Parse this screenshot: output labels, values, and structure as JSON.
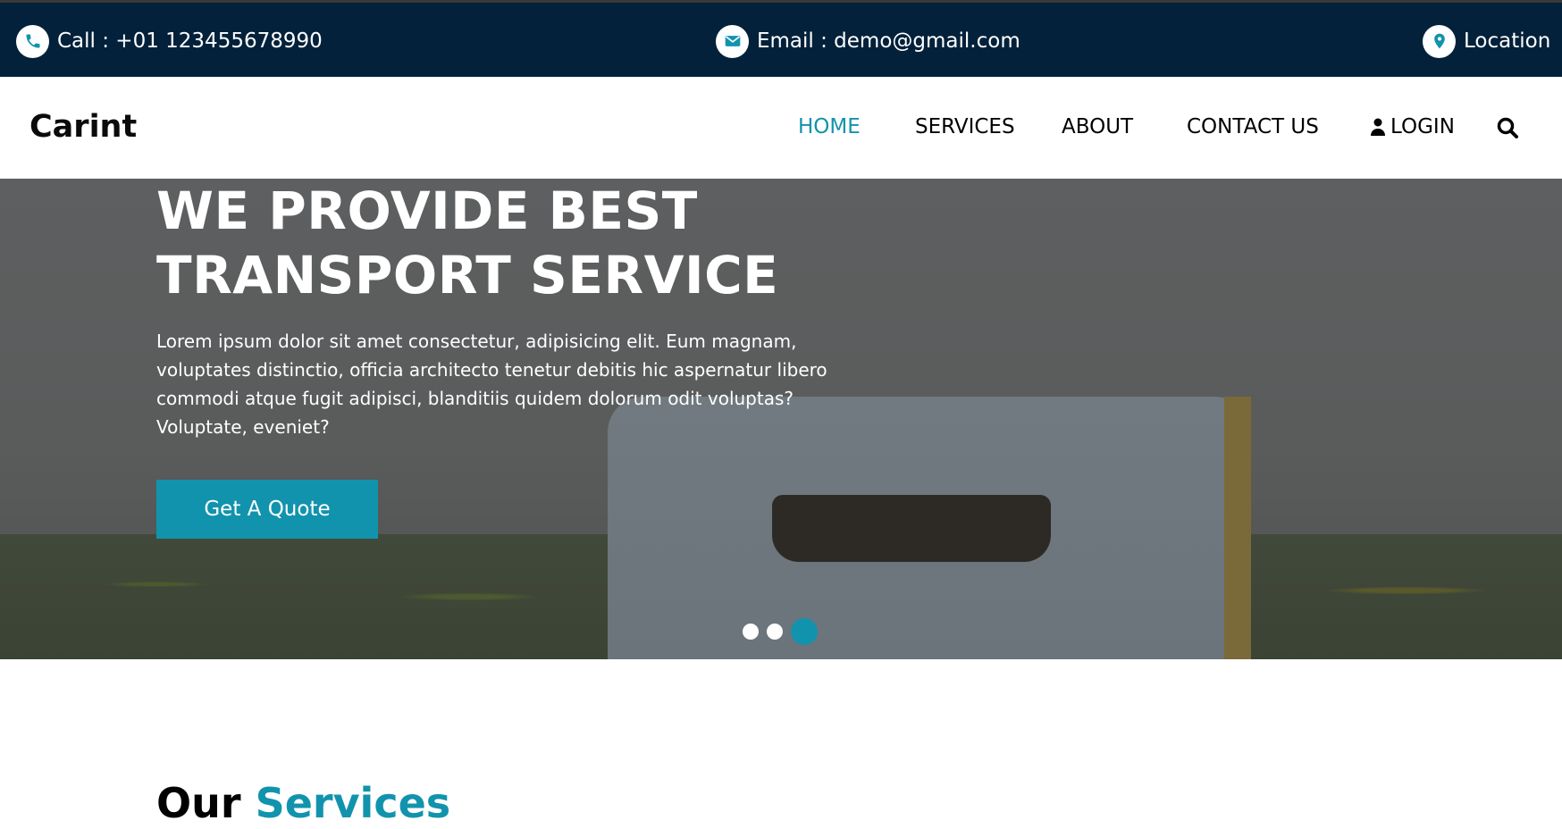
{
  "topbar": {
    "call": "Call : +01 123455678990",
    "email": "Email : demo@gmail.com",
    "location": "Location"
  },
  "brand": "Carint",
  "nav": {
    "home": "HOME",
    "services": "SERVICES",
    "about": "ABOUT",
    "contact": "CONTACT US",
    "login": "LOGIN"
  },
  "hero": {
    "title_line1": "WE PROVIDE BEST",
    "title_line2": "TRANSPORT SERVICE",
    "text": "Lorem ipsum dolor sit amet consectetur, adipisicing elit. Eum magnam, voluptates distinctio, officia architecto tenetur debitis hic aspernatur libero commodi atque fugit adipisci, blanditiis quidem dolorum odit voluptas? Voluptate, eveniet?",
    "button": "Get A Quote",
    "active_slide": 3
  },
  "services": {
    "heading_part1": "Our",
    "heading_part2": "Services"
  },
  "colors": {
    "accent": "#1293ad",
    "topbar": "#03213a"
  }
}
